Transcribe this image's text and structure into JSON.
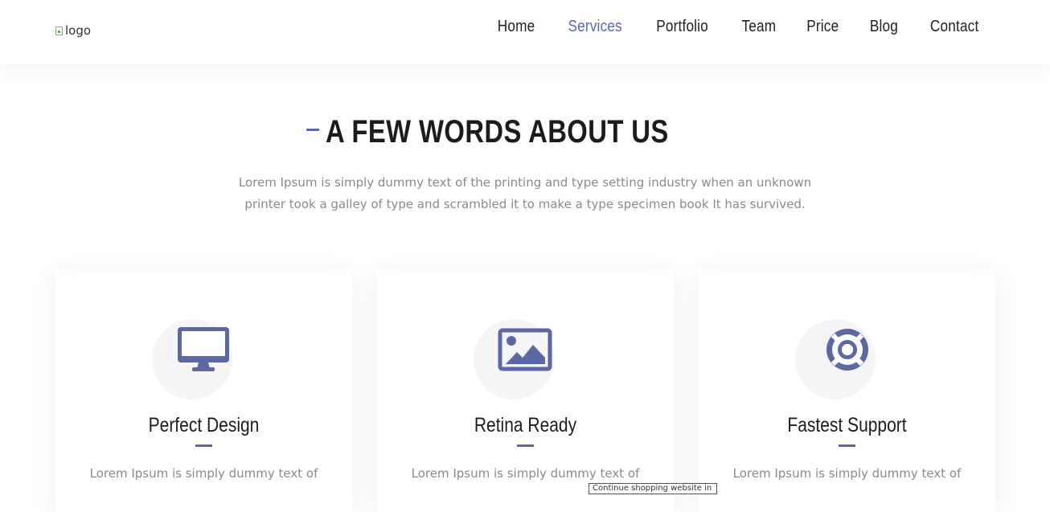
{
  "header": {
    "logo_alt": "logo",
    "nav": [
      {
        "label": "Home",
        "active": false
      },
      {
        "label": "Services",
        "active": true
      },
      {
        "label": "Portfolio",
        "active": false
      },
      {
        "label": "Team",
        "active": false
      },
      {
        "label": "Price",
        "active": false
      },
      {
        "label": "Blog",
        "active": false
      },
      {
        "label": "Contact",
        "active": false
      }
    ]
  },
  "about": {
    "heading": "A FEW WORDS ABOUT US",
    "intro_line1": "Lorem Ipsum is simply dummy text of the printing and type setting industry when an unknown",
    "intro_line2": "printer took a galley of type and scrambled it to make a type specimen book It has survived."
  },
  "features": [
    {
      "icon": "monitor-icon",
      "title": "Perfect Design",
      "text": "Lorem Ipsum is simply dummy text of"
    },
    {
      "icon": "image-icon",
      "title": "Retina Ready",
      "text": "Lorem Ipsum is simply dummy text of"
    },
    {
      "icon": "lifebuoy-icon",
      "title": "Fastest Support",
      "text": "Lorem Ipsum is simply dummy text of"
    }
  ],
  "tooltip": {
    "text": "Continue shopping website in"
  },
  "colors": {
    "accent": "#5b68a4",
    "heading": "#1c1c1c",
    "body_text": "#8a8a8a",
    "icon_bg": "#f5f5f7"
  }
}
